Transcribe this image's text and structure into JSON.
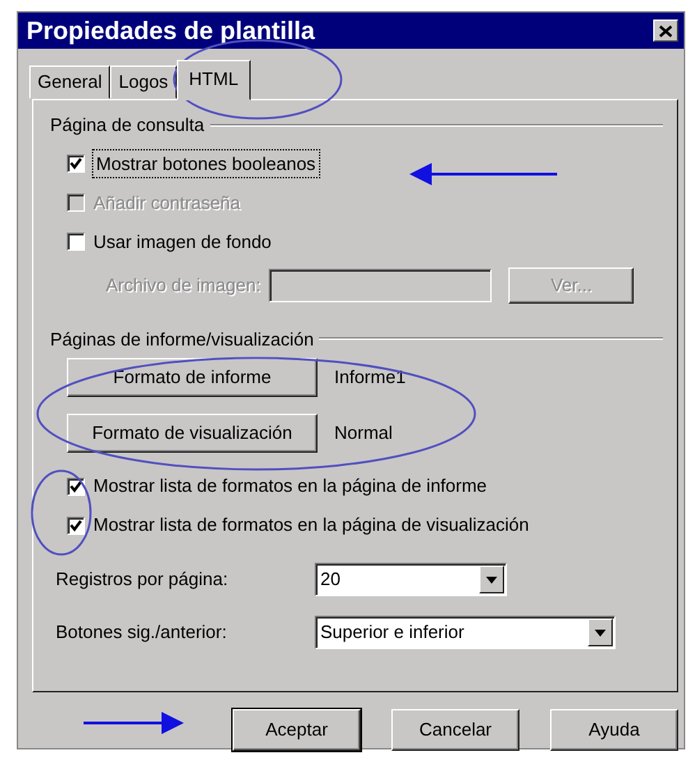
{
  "window": {
    "title": "Propiedades de plantilla"
  },
  "tabs": [
    {
      "label": "General",
      "selected": false
    },
    {
      "label": "Logos",
      "selected": false
    },
    {
      "label": "HTML",
      "selected": true
    }
  ],
  "consulta": {
    "title": "Página de consulta",
    "options": [
      {
        "label": "Mostrar botones booleanos",
        "checked": true,
        "disabled": false,
        "focused": true
      },
      {
        "label": "Añadir contraseña",
        "checked": false,
        "disabled": true,
        "focused": false
      },
      {
        "label": "Usar imagen de fondo",
        "checked": false,
        "disabled": false,
        "focused": false
      }
    ],
    "image_file": {
      "label": "Archivo de imagen:",
      "disabled": true,
      "button": "Ver..."
    }
  },
  "informe": {
    "title": "Páginas de informe/visualización",
    "formats": [
      {
        "button": "Formato de informe",
        "value": "Informe1"
      },
      {
        "button": "Formato de visualización",
        "value": "Normal"
      }
    ],
    "options": [
      {
        "label": "Mostrar lista de formatos en la página de informe",
        "checked": true,
        "disabled": false,
        "focused": false
      },
      {
        "label": "Mostrar lista de formatos en la página de visualización",
        "checked": true,
        "disabled": false,
        "focused": false
      }
    ],
    "fields": [
      {
        "label": "Registros por página:",
        "value": "20",
        "wide": false
      },
      {
        "label": "Botones sig./anterior:",
        "value": "Superior e inferior",
        "wide": true
      }
    ]
  },
  "buttons": [
    {
      "label": "Aceptar",
      "default": true
    },
    {
      "label": "Cancelar",
      "default": false
    },
    {
      "label": "Ayuda",
      "default": false
    }
  ]
}
